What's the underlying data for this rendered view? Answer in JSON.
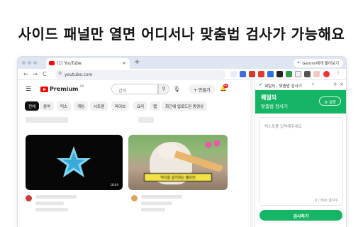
{
  "headline": "사이드 패널만 열면 어디서나 맞춤법 검사가 가능해요",
  "browser": {
    "tab_title": "(1) YouTube",
    "tab_close": "×",
    "new_tab": "+",
    "gemini_button": "Gemini에게 물어보기",
    "url": "youtube.com",
    "nav_back": "←",
    "nav_forward": "→",
    "nav_reload": "C"
  },
  "youtube": {
    "logo_text": "Premium",
    "logo_region": "KR",
    "search_placeholder": "검색",
    "search_icon": "search-icon",
    "create_label": "+ 만들기",
    "notification_count": "9+",
    "chips": [
      "전체",
      "음악",
      "믹스",
      "게임",
      "시트콤",
      "라이브",
      "요리",
      "랩",
      "최근에 업로드된 동영상"
    ],
    "video2_caption": "먹이를 삼키려는 펠리컨",
    "video1_badge": "18:04"
  },
  "side_panel": {
    "header_title": "웨일되 - 맞춤법 검사기",
    "app_name": "웨일되",
    "app_subtitle": "맞춤법 검사기",
    "settings_label": "설정",
    "textarea_placeholder": "텍스트를 입력해주세요",
    "char_count": "0 / 800 글자수",
    "check_button": "검사하기"
  },
  "colors": {
    "accent_green": "#16b565",
    "youtube_red": "#ff0000"
  }
}
